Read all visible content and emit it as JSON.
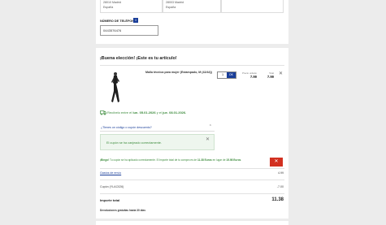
{
  "addresses": [
    {
      "line1": "28010 Madrid",
      "line2": "España"
    },
    {
      "line1": "28003 Madrid",
      "line2": "España"
    }
  ],
  "phone": {
    "label": "NÚMERO DE TELÉFONO",
    "info_glyph": "i",
    "value": "0443576476"
  },
  "cart": {
    "heading": "¡Buena elección! ¡Este es tu artículo!",
    "product": {
      "name": "Malla técnica para mujer (Estampado, M (42/44))",
      "quantity": "1",
      "qty_button": "OK",
      "unit_price_label": "Precio unitario",
      "unit_price": "7.99",
      "total_label": "Total",
      "total": "7.99"
    },
    "delivery": {
      "prefix": "Recíbelo entre el",
      "from": "lun. 05.01.2026",
      "mid": "y el",
      "to": "jue. 08.01.2026."
    },
    "coupon": {
      "question": "¿Tienes un código o cupón descuento?",
      "success": "El cupón se ha canjeado correctamente."
    },
    "promo": {
      "bold": "¡Bingo!",
      "text1": "Tu cupón se ha aplicado correctamente. El importe total de tu compra es de",
      "total": "11.38 Euros",
      "text2": "en lugar de",
      "original": "15.98 Euros",
      "end": "."
    },
    "summary": {
      "shipping_label": "Gastos de envío",
      "shipping_value": "4.99",
      "coupon_label": "Cupón (YLAC026)",
      "coupon_value": "-7.00",
      "total_label": "Importe total",
      "total_value": "11.38",
      "returns_note": "Devoluciones gratuitas hasta 30 días"
    }
  },
  "colors": {
    "brand_blue": "#1a3e99",
    "success_green": "#3a8a3a",
    "cta_red": "#d23020"
  }
}
